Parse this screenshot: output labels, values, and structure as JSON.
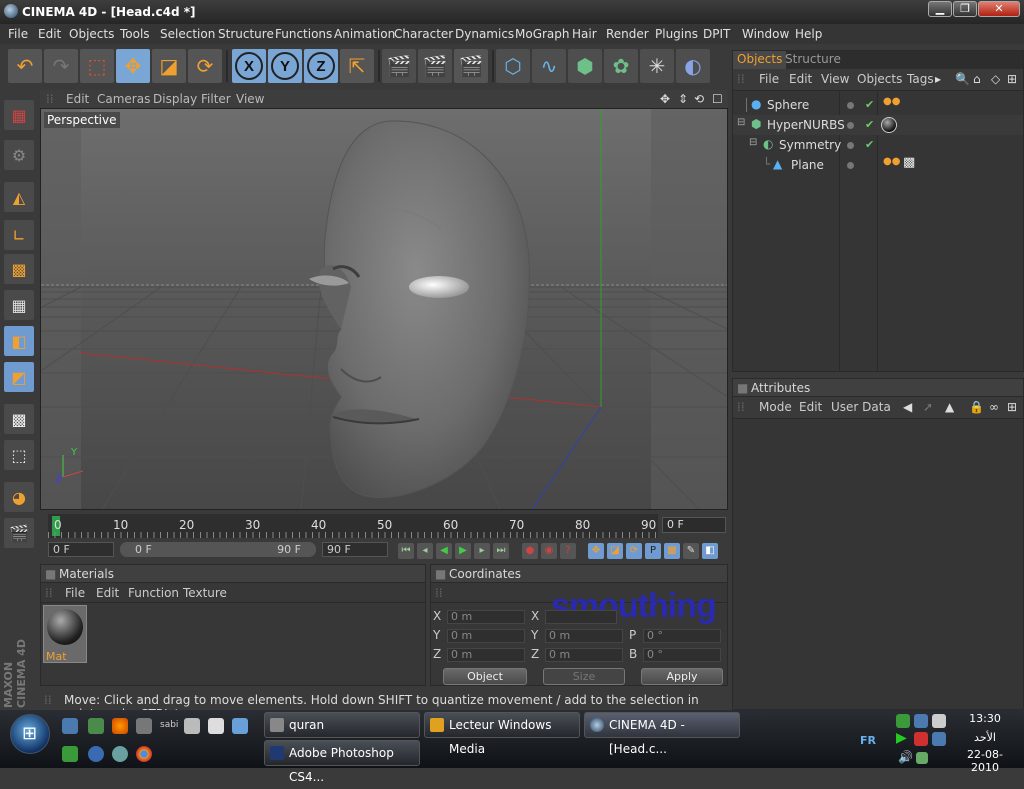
{
  "window": {
    "title": "CINEMA 4D - [Head.c4d *]",
    "min": "▁",
    "max": "❐",
    "close": "✕"
  },
  "menu": [
    "File",
    "Edit",
    "Objects",
    "Tools",
    "Selection",
    "Structure",
    "Functions",
    "Animation",
    "Character",
    "Dynamics",
    "MoGraph",
    "Hair",
    "Render",
    "Plugins",
    "DPIT",
    "Window",
    "Help"
  ],
  "axis_labels": {
    "x": "X",
    "y": "Y",
    "z": "Z"
  },
  "viewport": {
    "menu": [
      "Edit",
      "Cameras",
      "Display",
      "Filter",
      "View"
    ],
    "label": "Perspective"
  },
  "timeline": {
    "ticks": [
      "0",
      "10",
      "20",
      "30",
      "40",
      "50",
      "60",
      "70",
      "80",
      "90"
    ],
    "current_frame": "0 F"
  },
  "playback": {
    "start": "0 F",
    "range_start": "0 F",
    "range_end": "90 F",
    "end": "90 F"
  },
  "materials": {
    "title": "Materials",
    "menu": [
      "File",
      "Edit",
      "Function",
      "Texture"
    ],
    "items": [
      {
        "name": "Mat"
      }
    ]
  },
  "coordinates": {
    "title": "Coordinates",
    "rows": [
      {
        "a": "X",
        "av": "0 m",
        "b": "X",
        "bv": "",
        "c": "",
        "cv": ""
      },
      {
        "a": "Y",
        "av": "0 m",
        "b": "Y",
        "bv": "0 m",
        "c": "P",
        "cv": "0 °"
      },
      {
        "a": "Z",
        "av": "0 m",
        "b": "Z",
        "bv": "0 m",
        "c": "B",
        "cv": "0 °"
      }
    ],
    "mode": "Object",
    "size": "Size",
    "apply": "Apply",
    "overlay": "smouthing"
  },
  "status": "Move: Click and drag to move elements. Hold down SHIFT to quantize movement / add to the selection in point mode, CTRL to remove.",
  "objects_panel": {
    "tabs": [
      "Objects",
      "Structure"
    ],
    "menu": [
      "File",
      "Edit",
      "View",
      "Objects",
      "Tags"
    ],
    "tree": [
      {
        "name": "Sphere",
        "indent": 0
      },
      {
        "name": "HyperNURBS",
        "indent": 0
      },
      {
        "name": "Symmetry",
        "indent": 1
      },
      {
        "name": "Plane",
        "indent": 2
      }
    ]
  },
  "attributes_panel": {
    "title": "Attributes",
    "menu": [
      "Mode",
      "Edit",
      "User Data"
    ]
  },
  "branding": "MAXON CINEMA 4D",
  "taskbar": {
    "tasks": [
      "quran",
      "Lecteur Windows Media",
      "CINEMA 4D - [Head.c...",
      "Adobe Photoshop CS4..."
    ],
    "lang": "FR",
    "time": "13:30",
    "day": "الأحد",
    "date": "22-08-2010",
    "quicklaunch_label": "sabi"
  }
}
